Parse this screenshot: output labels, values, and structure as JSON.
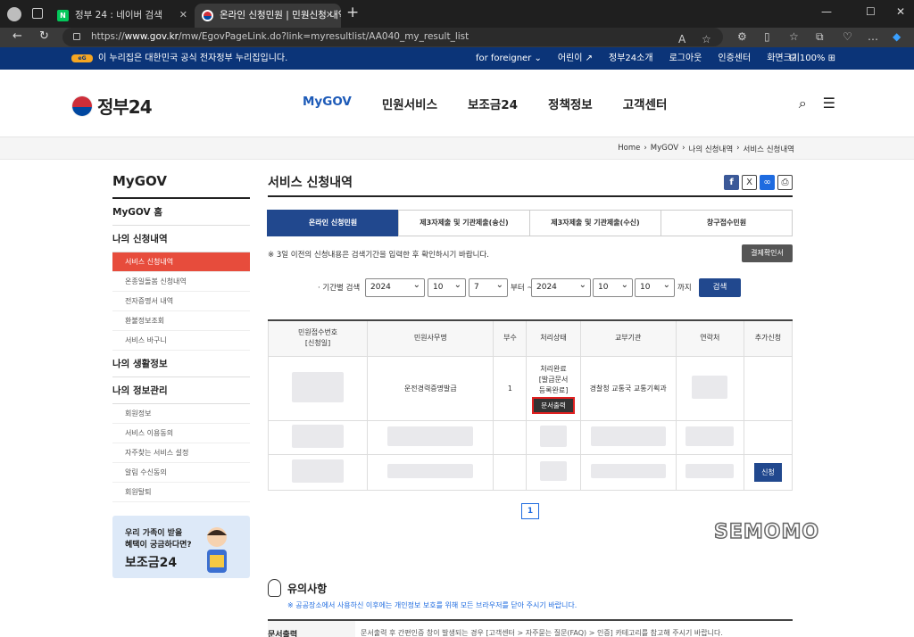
{
  "browser": {
    "tabs": [
      {
        "label": "정부 24 : 네이버 검색",
        "favicon": "N"
      },
      {
        "label": "온라인 신청민원 | 민원신청 내역"
      }
    ],
    "url_prefix": "https://",
    "url_domain": "www.gov.kr",
    "url_path": "/mw/EgovPageLink.do?link=myresultlist/AA040_my_result_list"
  },
  "govbar": {
    "message": "이 누리집은 대한민국 공식 전자정부 누리집입니다.",
    "links": [
      "for foreigner ⌄",
      "어린이 ↗",
      "정부24소개",
      "로그아웃",
      "인증센터",
      "화면크기"
    ],
    "zoom": "100%"
  },
  "header": {
    "logo": "정부24",
    "nav": [
      "MyGOV",
      "민원서비스",
      "보조금24",
      "정책정보",
      "고객센터"
    ]
  },
  "breadcrumb": [
    "Home",
    "MyGOV",
    "나의 신청내역",
    "서비스 신청내역"
  ],
  "sidebar": {
    "title": "MyGOV",
    "home": "MyGOV 홈",
    "group1": "나의 신청내역",
    "group1_items": [
      "서비스 신청내역",
      "온종일돌봄 신청내역",
      "전자증명서 내역",
      "환불정보조회",
      "서비스 바구니"
    ],
    "group2": "나의 생활정보",
    "group3": "나의 정보관리",
    "group3_items": [
      "회원정보",
      "서비스 이용동의",
      "자주찾는 서비스 설정",
      "알림 수신동의",
      "회원탈퇴"
    ],
    "banner_line1": "우리 가족이 받을",
    "banner_line2": "혜택이 궁금하다면?",
    "banner_title": "보조금24"
  },
  "main": {
    "title": "서비스 신청내역",
    "tabs": [
      "온라인 신청민원",
      "제3자제출 및 기관제출(송신)",
      "제3자제출 및 기관제출(수신)",
      "창구접수민원"
    ],
    "note": "※ 3일 이전의 신청내용은 검색기간을 입력한 후 확인하시기 바랍니다.",
    "pay_button": "결제확인서",
    "search": {
      "label": "· 기간별 검색",
      "from_year": "2024",
      "from_month": "10",
      "from_day": "7",
      "from_suffix": "부터 ~",
      "to_year": "2024",
      "to_month": "10",
      "to_day": "10",
      "to_suffix": "까지",
      "button": "검색"
    },
    "table": {
      "headers": [
        "민원접수번호\n[신청일]",
        "민원사무명",
        "부수",
        "처리상태",
        "교부기관",
        "연락처",
        "추가신청"
      ],
      "row1": {
        "service": "운전경력증명발급",
        "copies": "1",
        "status": "처리완료\n[발급문서\n등록완료]",
        "print_button": "문서출력",
        "agency": "경찰청 교통국 교통기획과"
      },
      "apply_button": "신청"
    },
    "page": "1"
  },
  "caution": {
    "title": "유의사항",
    "desc": "※ 공공장소에서 사용하신 이후에는 개인정보 보호를 위해 모든 브라우저를 닫아 주시기 바랍니다.",
    "row_label": "문서출력",
    "row_text": "문서출력 후 간편인증 창이 발생되는 경우 [고객센터 > 자주묻는 질문(FAQ) > 인증] 카테고리를 참고해 주시기 바랍니다."
  },
  "watermark": "SEMOMO"
}
